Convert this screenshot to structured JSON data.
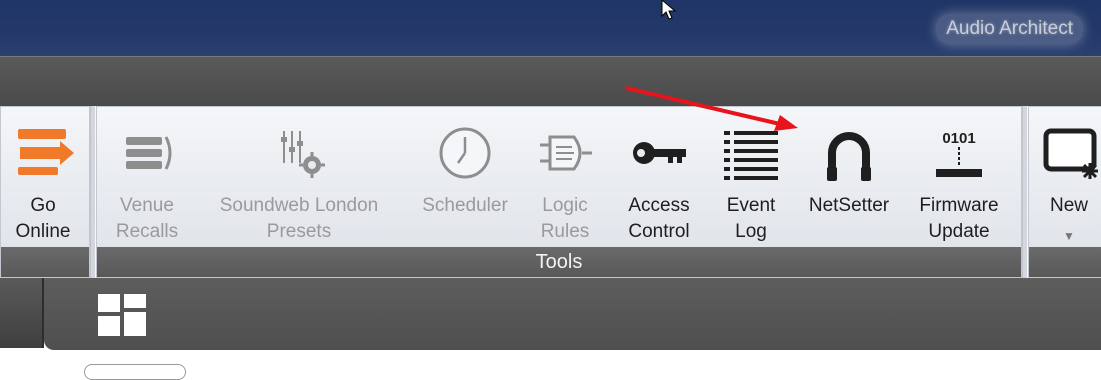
{
  "app": {
    "title": "Audio Architect"
  },
  "ribbon": {
    "groups": [
      {
        "label": ""
      },
      {
        "label": "Tools"
      },
      {
        "label": ""
      }
    ],
    "buttons": [
      {
        "label": "Go\nOnline",
        "icon": "go-online-icon",
        "enabled": true
      },
      {
        "label": "Venue\nRecalls",
        "icon": "venue-recalls-icon",
        "enabled": false
      },
      {
        "label": "Soundweb London\nPresets",
        "icon": "soundweb-presets-icon",
        "enabled": false
      },
      {
        "label": "Scheduler",
        "icon": "clock-icon",
        "enabled": false
      },
      {
        "label": "Logic\nRules",
        "icon": "logic-rules-icon",
        "enabled": false
      },
      {
        "label": "Access\nControl",
        "icon": "key-icon",
        "enabled": true
      },
      {
        "label": "Event\nLog",
        "icon": "list-icon",
        "enabled": true
      },
      {
        "label": "NetSetter",
        "icon": "netsetter-icon",
        "enabled": true
      },
      {
        "label": "Firmware\nUpdate",
        "icon": "firmware-icon",
        "enabled": true
      },
      {
        "label": "New",
        "icon": "new-window-icon",
        "enabled": true
      }
    ]
  },
  "colors": {
    "titlebar": "#24396a",
    "accent_orange": "#f07a2a",
    "annotation_arrow": "#e8141c"
  }
}
